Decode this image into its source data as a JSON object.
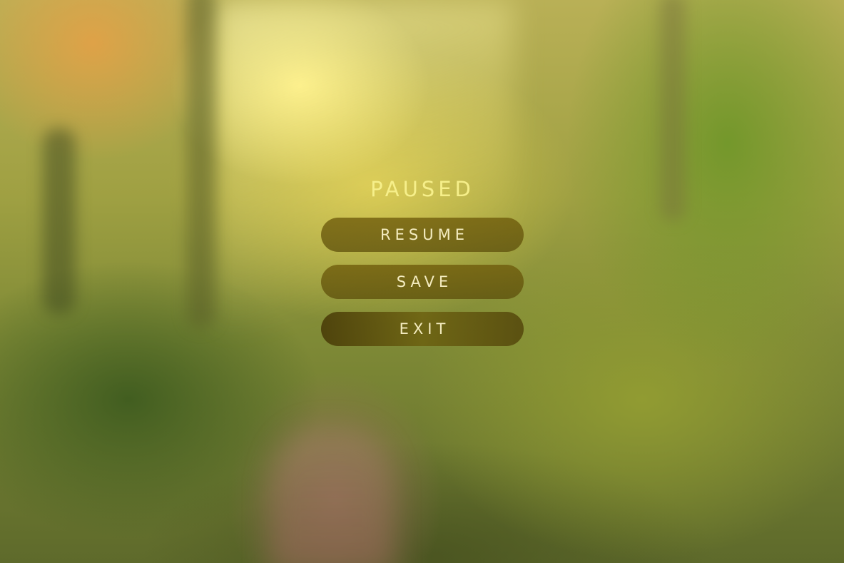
{
  "pause_menu": {
    "title": "PAUSED",
    "buttons": {
      "resume": "RESUME",
      "save": "SAVE",
      "exit": "EXIT"
    }
  }
}
